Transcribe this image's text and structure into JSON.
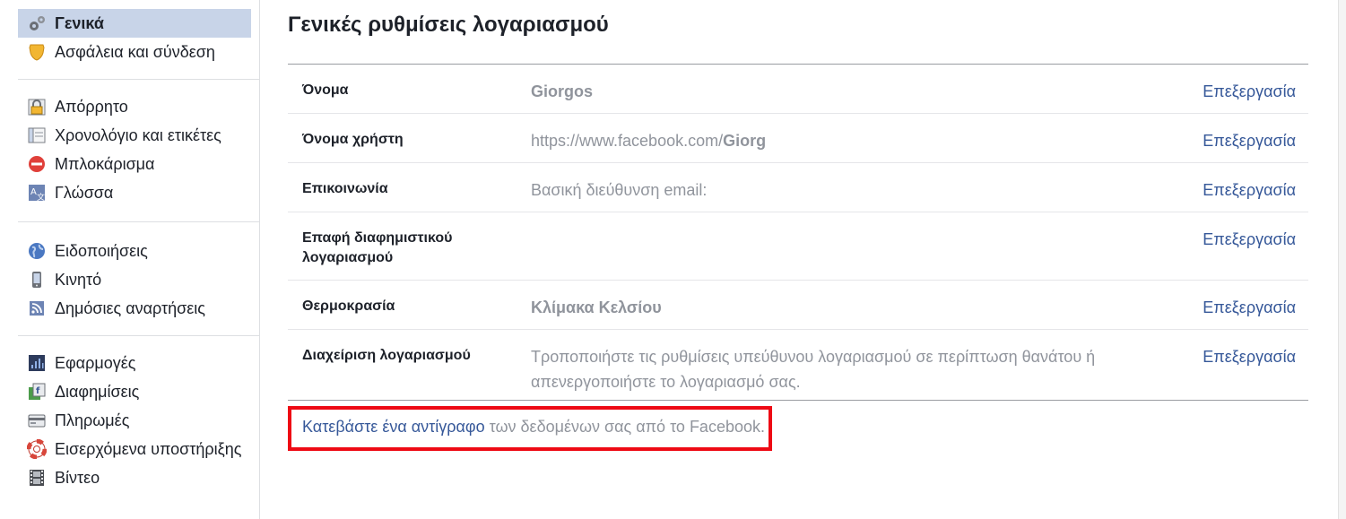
{
  "sidebar": {
    "groups": [
      [
        {
          "label": "Γενικά",
          "icon": "gears-icon",
          "active": true
        },
        {
          "label": "Ασφάλεια και σύνδεση",
          "icon": "shield-icon"
        }
      ],
      [
        {
          "label": "Απόρρητο",
          "icon": "lock-icon"
        },
        {
          "label": "Χρονολόγιο και ετικέτες",
          "icon": "timeline-icon"
        },
        {
          "label": "Μπλοκάρισμα",
          "icon": "block-icon"
        },
        {
          "label": "Γλώσσα",
          "icon": "language-icon"
        }
      ],
      [
        {
          "label": "Ειδοποιήσεις",
          "icon": "globe-icon"
        },
        {
          "label": "Κινητό",
          "icon": "mobile-icon"
        },
        {
          "label": "Δημόσιες αναρτήσεις",
          "icon": "rss-icon"
        }
      ],
      [
        {
          "label": "Εφαρμογές",
          "icon": "apps-icon"
        },
        {
          "label": "Διαφημίσεις",
          "icon": "ads-icon"
        },
        {
          "label": "Πληρωμές",
          "icon": "credit-card-icon"
        },
        {
          "label": "Εισερχόμενα υποστήριξης",
          "icon": "lifebuoy-icon"
        },
        {
          "label": "Βίντεο",
          "icon": "film-icon"
        }
      ]
    ]
  },
  "main": {
    "title": "Γενικές ρυθμίσεις λογαριασμού",
    "rows": [
      {
        "label": "Όνομα",
        "value": "Giorgos",
        "value_strong": true,
        "edit": "Επεξεργασία"
      },
      {
        "label": "Όνομα χρήστη",
        "value_prefix": "https://www.facebook.com/",
        "value_bold": "Giorg",
        "edit": "Επεξεργασία"
      },
      {
        "label": "Επικοινωνία",
        "value": "Βασική διεύθυνση email:",
        "edit": "Επεξεργασία"
      },
      {
        "label": "Επαφή διαφημιστικού λογαριασμού",
        "value": "",
        "edit": "Επεξεργασία"
      },
      {
        "label": "Θερμοκρασία",
        "value": "Κλίμακα Κελσίου",
        "value_strong": true,
        "edit": "Επεξεργασία"
      },
      {
        "label": "Διαχείριση λογαριασμού",
        "value": "Τροποποιήστε τις ρυθμίσεις υπεύθυνου λογαριασμού σε περίπτωση θανάτου ή απενεργοποιήστε το λογαριασμό σας.",
        "edit": "Επεξεργασία"
      }
    ],
    "download": {
      "link": "Κατεβάστε ένα αντίγραφο",
      "rest": " των δεδομένων σας από το Facebook."
    }
  },
  "colors": {
    "accent": "#365899",
    "active_bg": "#c8d4e8",
    "highlight_border": "#ee0a14",
    "muted_text": "#90949c"
  }
}
